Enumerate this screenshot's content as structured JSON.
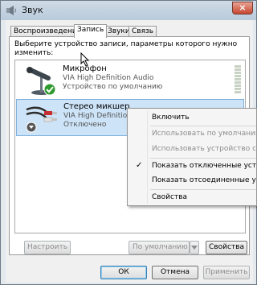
{
  "window": {
    "title": "Звук",
    "close_glyph": "×"
  },
  "tabs": [
    {
      "label": "Воспроизведение",
      "active": false
    },
    {
      "label": "Запись",
      "active": true
    },
    {
      "label": "Звуки",
      "active": false
    },
    {
      "label": "Связь",
      "active": false
    }
  ],
  "instructions": "Выберите устройство записи, параметры которого нужно изменить:",
  "devices": [
    {
      "name": "Микрофон",
      "driver": "VIA High Definition Audio",
      "status": "Устройство по умолчанию",
      "icon": "microphone-icon",
      "badge": "check-badge-icon",
      "selected": false
    },
    {
      "name": "Стерео микшер",
      "driver": "VIA High Definition Audio",
      "status": "Отключено",
      "icon": "audio-cable-icon",
      "badge": "down-arrow-badge-icon",
      "selected": true
    }
  ],
  "context_menu": {
    "items": [
      {
        "label": "Включить",
        "enabled": true,
        "checked": false
      },
      {
        "label": "Использовать по умолчанию",
        "enabled": false,
        "checked": false
      },
      {
        "label": "Использовать устройство связи",
        "enabled": false,
        "checked": false
      },
      {
        "label": "Показать отключенные устройства",
        "enabled": true,
        "checked": true
      },
      {
        "label": "Показать отсоединенные устройства",
        "enabled": true,
        "checked": false
      },
      {
        "label": "Свойства",
        "enabled": true,
        "checked": false
      }
    ],
    "check_glyph": "✓"
  },
  "panel_buttons": {
    "configure": "Настроить",
    "set_default": "По умолчанию",
    "properties": "Свойства"
  },
  "dialog_buttons": {
    "ok": "ОК",
    "cancel": "Отмена",
    "apply": "Применить"
  },
  "colors": {
    "selection": "#cde3f7",
    "check_badge": "#2e9a2e",
    "close_button": "#c6462f"
  }
}
